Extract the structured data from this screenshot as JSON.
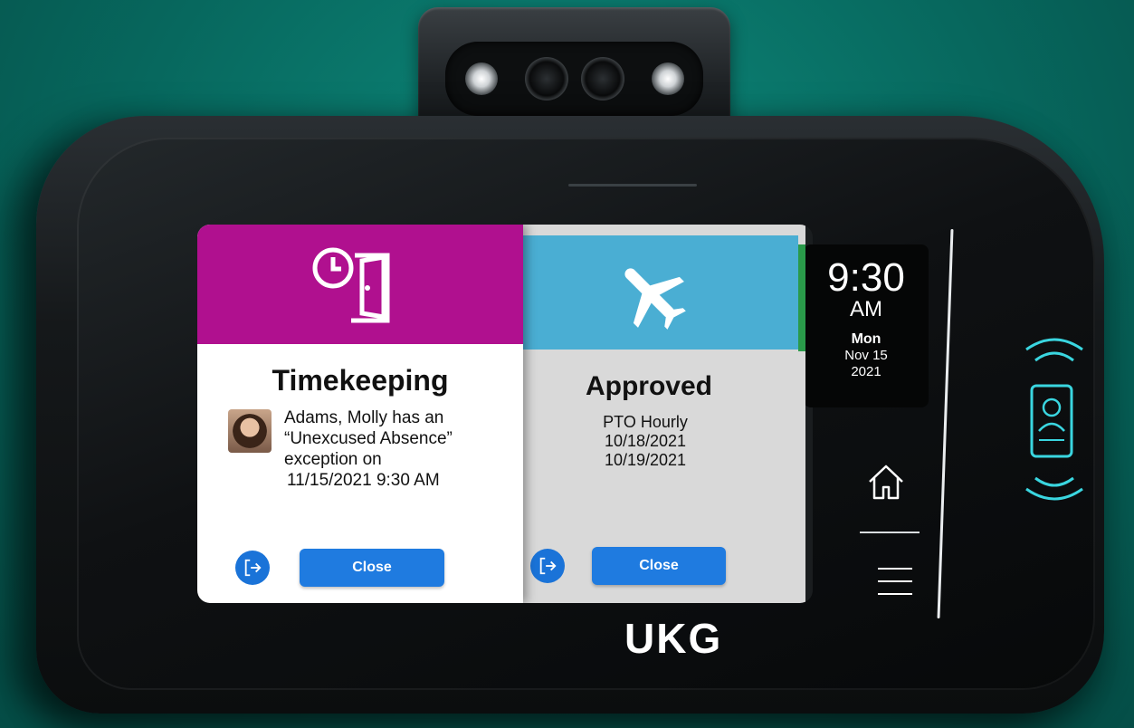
{
  "device": {
    "brand_logo": "UKG"
  },
  "cards": {
    "left": {
      "header_color": "#b0108f",
      "icon": "clock-door-icon",
      "title": "Timekeeping",
      "message_lines": [
        "Adams, Molly has an",
        "“Unexcused Absence”",
        "exception on",
        "11/15/2021 9:30 AM"
      ],
      "avatar": "employee-photo",
      "exit_icon": "exit-icon",
      "close_label": "Close"
    },
    "right": {
      "header_color": "#4aaed3",
      "icon": "airplane-icon",
      "title": "Approved",
      "details": [
        "PTO Hourly",
        "10/18/2021",
        "10/19/2021"
      ],
      "exit_icon": "exit-icon",
      "close_label": "Close"
    }
  },
  "clock": {
    "time": "9:30",
    "ampm": "AM",
    "weekday": "Mon",
    "date": "Nov 15",
    "year": "2021"
  },
  "side_controls": {
    "home_icon": "home-icon",
    "menu_icon": "hamburger-menu-icon",
    "badge_reader_icon": "badge-reader-icon"
  },
  "colors": {
    "button_blue": "#1f7be0",
    "badge_cyan": "#3ad6e0",
    "background_teal": "#07685e"
  }
}
